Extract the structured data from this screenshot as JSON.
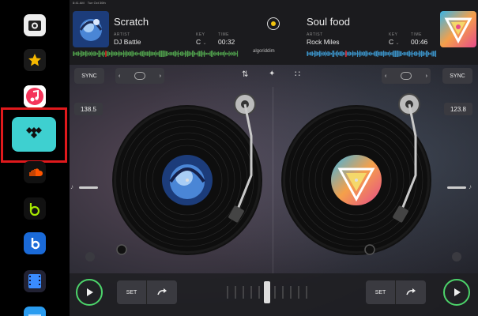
{
  "status_bar": {
    "time": "8:41 AM",
    "date": "Tue Oct 30th"
  },
  "sidebar": {
    "items": [
      {
        "name": "tidal-app",
        "color": "#3ed0d0"
      }
    ]
  },
  "deck_left": {
    "title": "Scratch",
    "artist_label": "ARTIST",
    "artist": "DJ Battle",
    "key_label": "KEY",
    "key": "C",
    "time_label": "TIME",
    "time": "00:32",
    "bpm": "138.5",
    "sync_label": "SYNC",
    "set_label": "SET"
  },
  "deck_right": {
    "title": "Soul food",
    "artist_label": "ARTIST",
    "artist": "Rock Miles",
    "key_label": "KEY",
    "key": "C",
    "time_label": "TIME",
    "time": "00:46",
    "bpm": "123.8",
    "sync_label": "SYNC",
    "set_label": "SET"
  },
  "brand": "algoriddim",
  "colors": {
    "accent_red": "#e0191c",
    "play_green": "#4cd36a",
    "center_yellow": "#f2c40f"
  }
}
